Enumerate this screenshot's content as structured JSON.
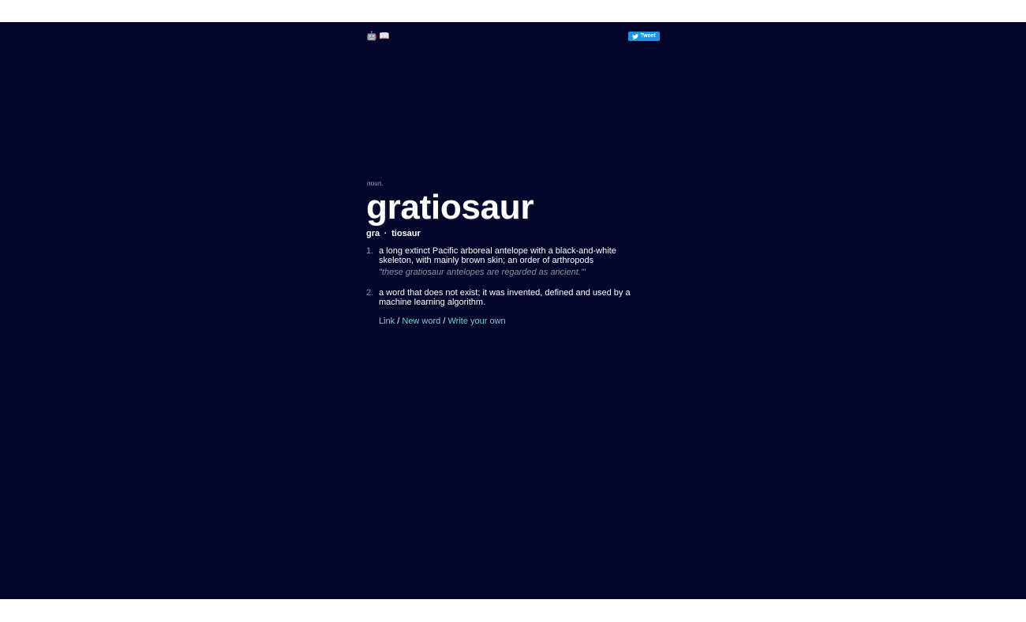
{
  "header": {
    "icons": [
      {
        "icon": "robot-icon",
        "glyph": "🤖"
      },
      {
        "icon": "book-icon",
        "glyph": "📖"
      }
    ],
    "tweet_label": "Tweet"
  },
  "entry": {
    "part_of_speech": "noun.",
    "word": "gratiosaur",
    "syllables": [
      "gra",
      "tiosaur"
    ],
    "syllable_separator": "·",
    "definitions": [
      {
        "number": "1.",
        "text": "a long extinct Pacific arboreal antelope with a black-and-white skeleton, with mainly brown skin; an order of arthropods",
        "example": "\"these gratiosaur antelopes are regarded as ancient.'\""
      },
      {
        "number": "2.",
        "text": "a word that does not exist; it was invented, defined and used by a machine learning algorithm.",
        "example": ""
      }
    ],
    "links": {
      "link_label": "Link",
      "new_word_label": "New word",
      "write_own_label": "Write your own",
      "separator": "/"
    }
  },
  "colors": {
    "background": "#04052b",
    "link": "#6fd3c7",
    "tweet_button": "#1b95e0"
  }
}
